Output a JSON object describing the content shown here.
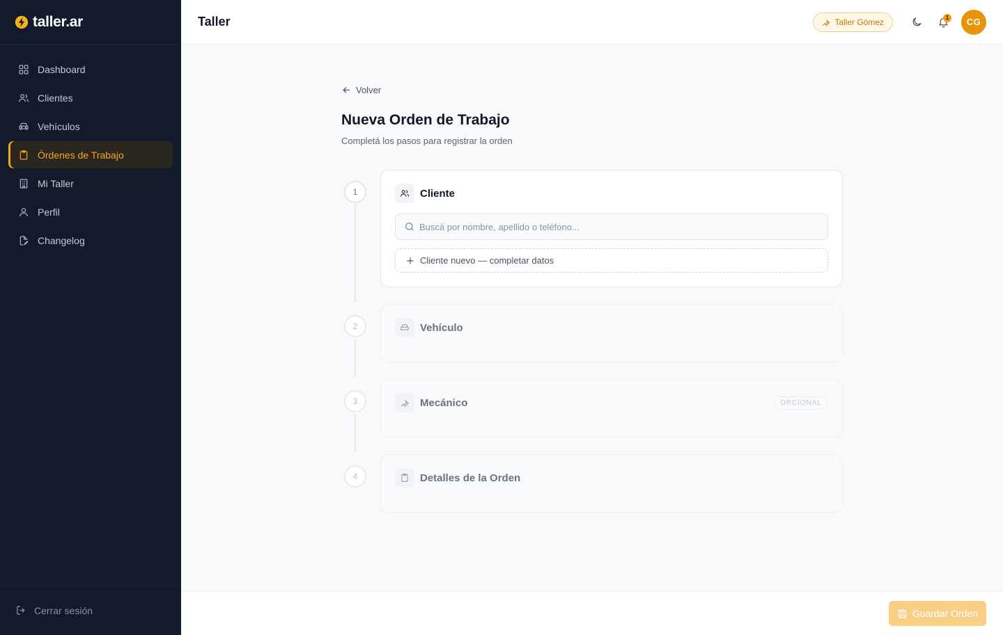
{
  "app": {
    "logo_text": "taller.ar"
  },
  "sidebar": {
    "items": [
      {
        "label": "Dashboard",
        "icon": "grid-icon"
      },
      {
        "label": "Clientes",
        "icon": "users-icon"
      },
      {
        "label": "Vehículos",
        "icon": "car-icon"
      },
      {
        "label": "Órdenes de Trabajo",
        "icon": "clipboard-icon",
        "active": true
      },
      {
        "label": "Mi Taller",
        "icon": "building-icon"
      },
      {
        "label": "Perfil",
        "icon": "user-icon"
      },
      {
        "label": "Changelog",
        "icon": "file-edit-icon"
      }
    ],
    "logout_label": "Cerrar sesión"
  },
  "header": {
    "title": "Taller",
    "shop_badge": "Taller Gómez",
    "notification_count": "1",
    "avatar_initials": "CG"
  },
  "page": {
    "back_label": "Volver",
    "title": "Nueva Orden de Trabajo",
    "subtitle": "Completá los pasos para registrar la orden"
  },
  "steps": [
    {
      "number": "1",
      "title": "Cliente",
      "icon": "users-icon",
      "active": true
    },
    {
      "number": "2",
      "title": "Vehículo",
      "icon": "car-icon"
    },
    {
      "number": "3",
      "title": "Mecánico",
      "icon": "wrench-icon",
      "tag": "OPCIONAL"
    },
    {
      "number": "4",
      "title": "Detalles de la Orden",
      "icon": "clipboard-icon"
    }
  ],
  "client_step": {
    "search_placeholder": "Buscá por nombre, apellido o teléfono...",
    "new_client_label": "Cliente nuevo — completar datos"
  },
  "footer": {
    "save_label": "Guardar Orden"
  },
  "colors": {
    "accent": "#f5a524",
    "sidebar_bg": "#131a2c",
    "avatar_bg": "#e8930a"
  }
}
